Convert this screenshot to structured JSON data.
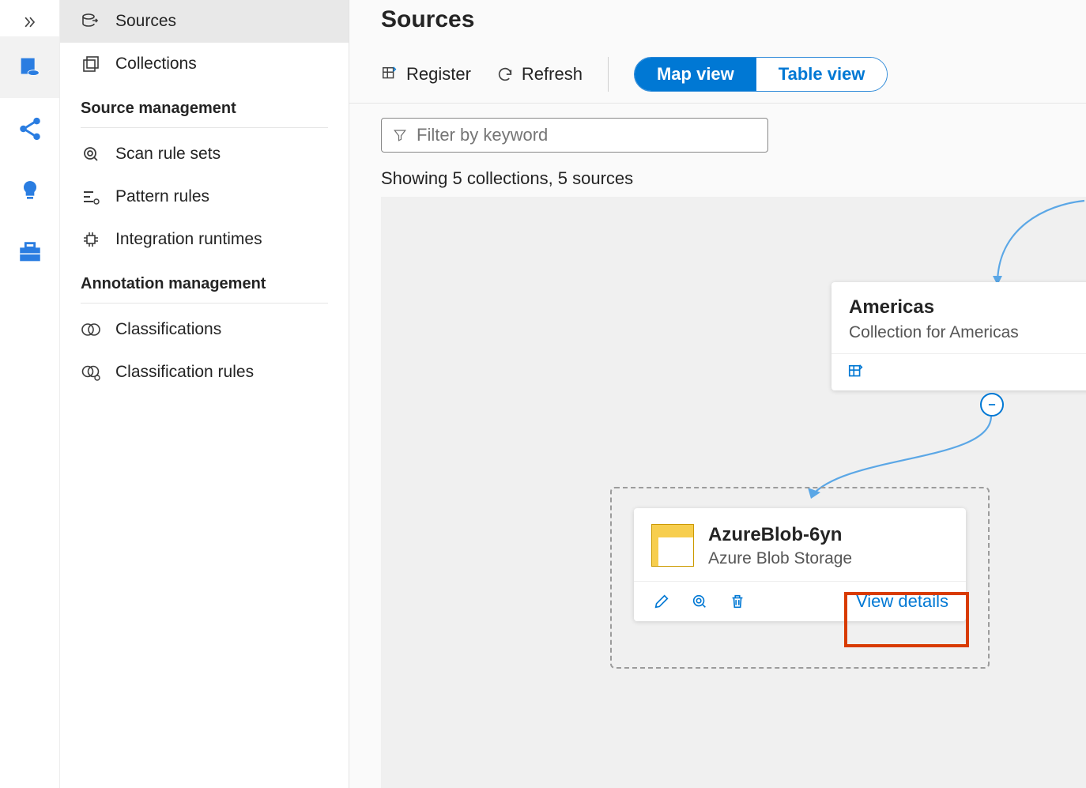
{
  "rail": {
    "toggle_icon": "expand"
  },
  "sidebar": {
    "nav": [
      {
        "label": "Sources",
        "icon": "source-out"
      },
      {
        "label": "Collections",
        "icon": "collections"
      }
    ],
    "sections": [
      {
        "title": "Source management",
        "items": [
          {
            "label": "Scan rule sets",
            "icon": "scan"
          },
          {
            "label": "Pattern rules",
            "icon": "pattern"
          },
          {
            "label": "Integration runtimes",
            "icon": "runtime"
          }
        ]
      },
      {
        "title": "Annotation management",
        "items": [
          {
            "label": "Classifications",
            "icon": "venn"
          },
          {
            "label": "Classification rules",
            "icon": "venn-gear"
          }
        ]
      }
    ]
  },
  "page": {
    "title": "Sources",
    "toolbar": {
      "register": "Register",
      "refresh": "Refresh",
      "view_map": "Map view",
      "view_table": "Table view"
    },
    "filter_placeholder": "Filter by keyword",
    "status": "Showing 5 collections, 5 sources"
  },
  "map": {
    "collection": {
      "name": "Americas",
      "desc": "Collection for Americas"
    },
    "source": {
      "name": "AzureBlob-6yn",
      "type": "Azure Blob Storage",
      "view_details": "View details"
    }
  }
}
